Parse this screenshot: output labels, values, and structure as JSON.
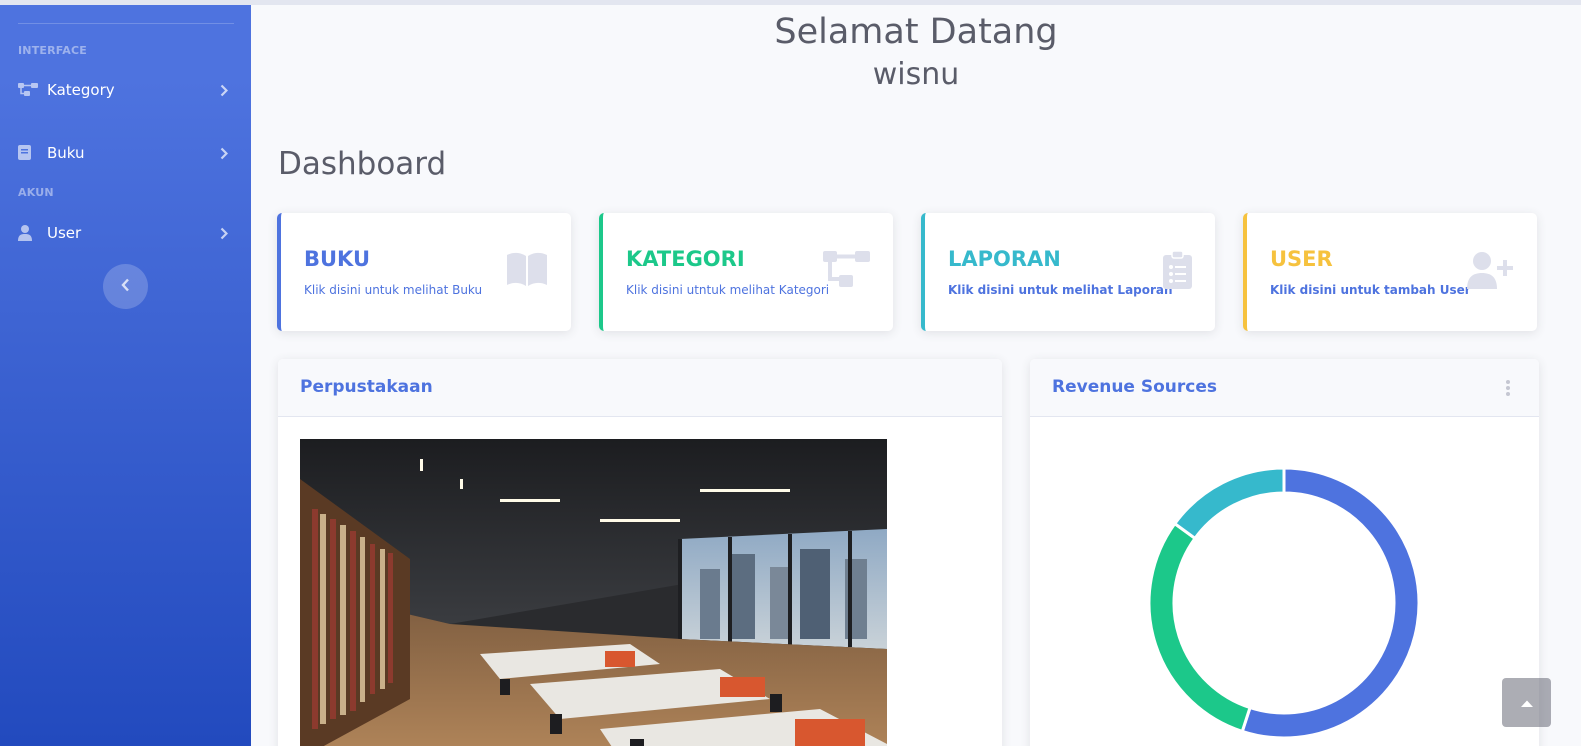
{
  "sidebar": {
    "headings": [
      "INTERFACE",
      "AKUN"
    ],
    "items": [
      {
        "label": "Kategory",
        "icon": "sitemap-icon"
      },
      {
        "label": "Buku",
        "icon": "book-icon"
      },
      {
        "label": "User",
        "icon": "user-icon"
      }
    ],
    "toggle_icon": "chevron-left-icon"
  },
  "welcome": {
    "line1": "Selamat Datang",
    "line2": "wisnu"
  },
  "page_title": "Dashboard",
  "cards": [
    {
      "label": "BUKU",
      "desc": "Klik disini untuk melihat Buku",
      "color": "#4e73df",
      "icon": "book-open-icon"
    },
    {
      "label": "KATEGORI",
      "desc": "Klik disini utntuk melihat Kategori",
      "color": "#1cc88a",
      "icon": "sitemap-icon"
    },
    {
      "label": "LAPORAN",
      "desc": "Klik disini untuk melihat Laporan",
      "color": "#36b9cc",
      "icon": "clipboard-list-icon"
    },
    {
      "label": "USER",
      "desc": "Klik disini untuk tambah User",
      "color": "#f6c23e",
      "icon": "user-plus-icon"
    }
  ],
  "panels": {
    "library": {
      "title": "Perpustakaan"
    },
    "revenue": {
      "title": "Revenue Sources"
    }
  },
  "chart_data": {
    "type": "pie",
    "style": "doughnut",
    "values": [
      55,
      30,
      15
    ],
    "colors": [
      "#4e73df",
      "#1cc88a",
      "#36b9cc"
    ]
  },
  "colors": {
    "primary": "#4e73df",
    "success": "#1cc88a",
    "info": "#36b9cc",
    "warning": "#f6c23e"
  }
}
